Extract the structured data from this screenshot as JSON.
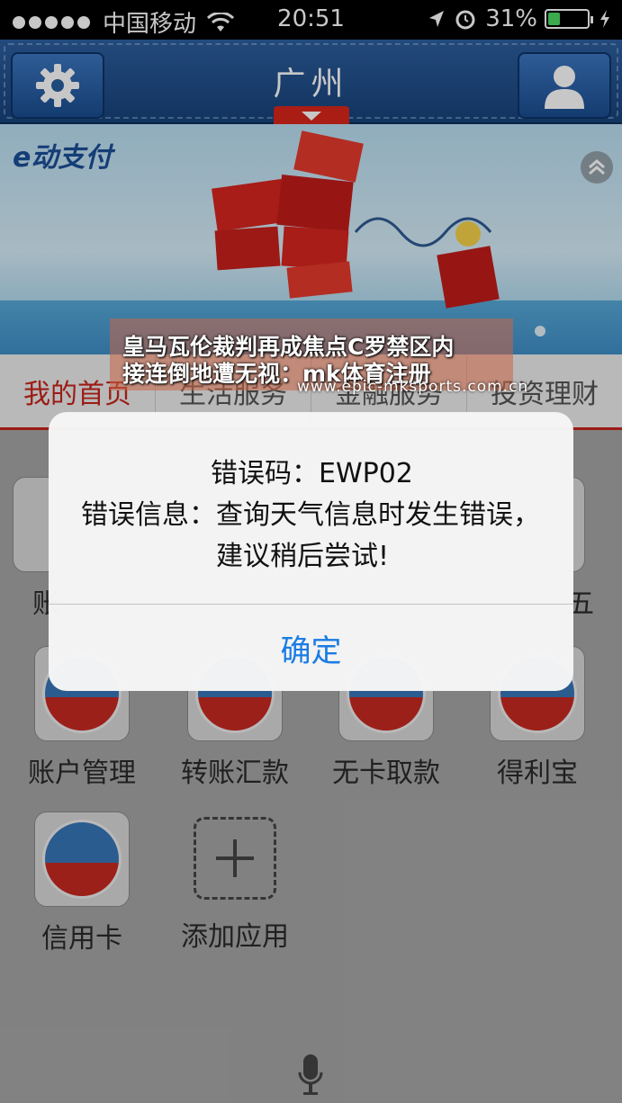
{
  "status_bar": {
    "carrier": "中国移动",
    "time": "20:51",
    "battery": "31%",
    "battery_level": 0.31,
    "icons": [
      "signal-dots",
      "wifi-icon",
      "location-arrow-icon",
      "alarm-icon",
      "battery-icon",
      "charging-icon"
    ]
  },
  "header": {
    "city": "广州",
    "left_icon": "gear-icon",
    "right_icon": "user-icon"
  },
  "banner": {
    "brand": "e动支付",
    "collapse_icon": "double-chevron-up-icon"
  },
  "tabs": [
    {
      "label": "我的首页",
      "active": true
    },
    {
      "label": "生活服务",
      "active": false
    },
    {
      "label": "金融服务",
      "active": false
    },
    {
      "label": "投资理财",
      "active": false
    }
  ],
  "grid": {
    "row1_partial": [
      "账",
      "五"
    ],
    "apps": [
      {
        "label": "账户管理",
        "icon": "account-icon"
      },
      {
        "label": "转账汇款",
        "icon": "transfer-icon"
      },
      {
        "label": "无卡取款",
        "icon": "cardless-withdraw-icon"
      },
      {
        "label": "得利宝",
        "icon": "delibao-icon"
      },
      {
        "label": "信用卡",
        "icon": "credit-card-icon"
      },
      {
        "label": "添加应用",
        "icon": "plus-icon"
      }
    ]
  },
  "alert": {
    "code_line": "错误码：EWP02",
    "message_line1": "错误信息：查询天气信息时发生错误，",
    "message_line2": "建议稍后尝试!",
    "confirm": "确定"
  },
  "watermark": {
    "line1": "皇马瓦伦裁判再成焦点C罗禁区内",
    "line2": "接连倒地遭无视：mk体育注册",
    "url": "www.epic-mksports.com.cn"
  },
  "colors": {
    "header_blue": "#1f4f8c",
    "accent_red": "#c7251c",
    "link_blue": "#1a7ce4"
  }
}
